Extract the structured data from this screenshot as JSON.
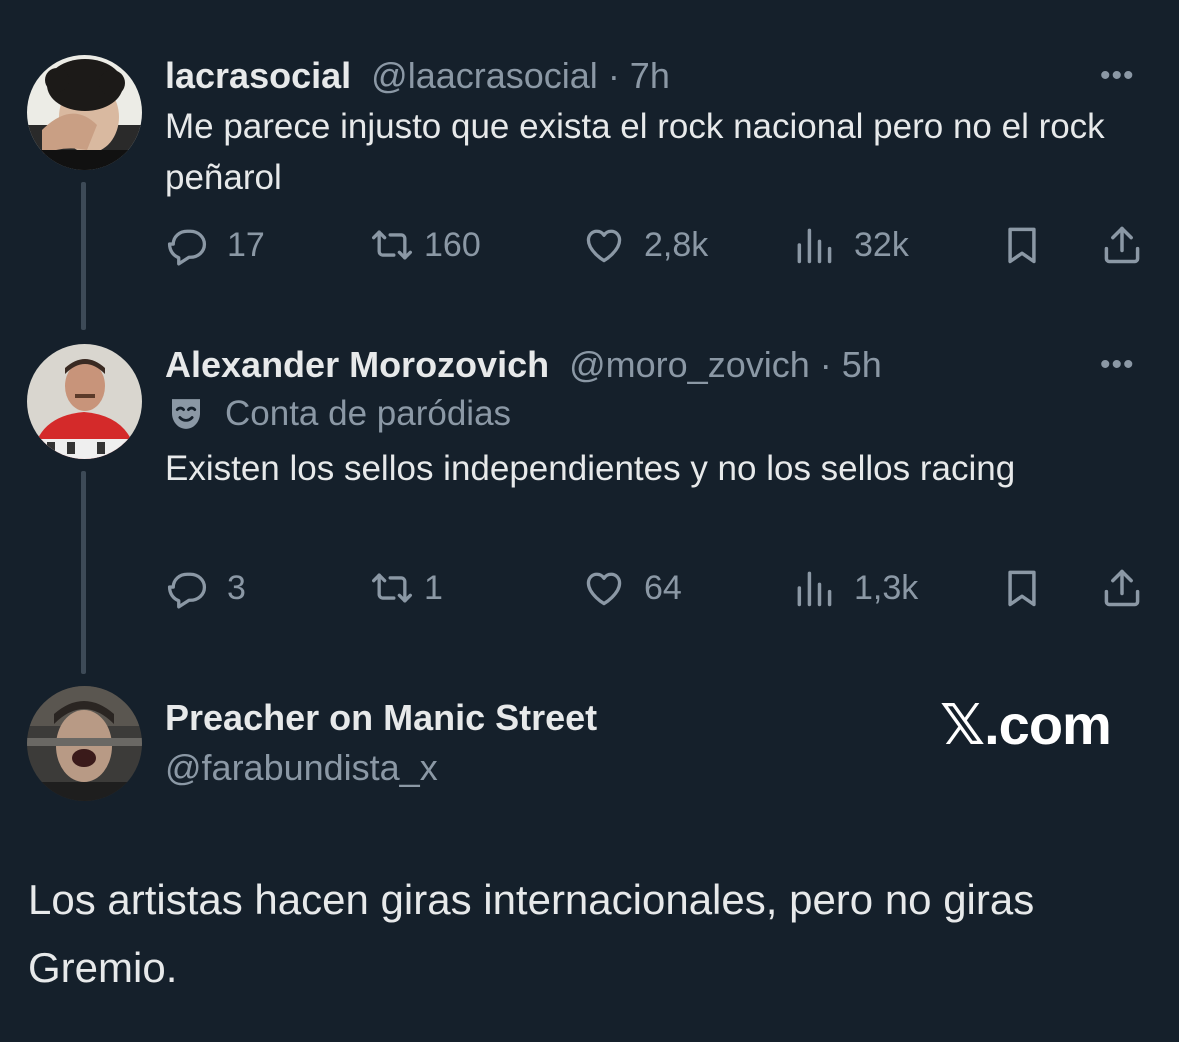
{
  "tweets": [
    {
      "name": "lacrasocial",
      "handle": "@laacrasocial",
      "time": "· 7h",
      "text": "Me parece injusto que exista el rock nacional pero no el rock peñarol",
      "replies": "17",
      "retweets": "160",
      "likes": "2,8k",
      "views": "32k",
      "more_label": "•••"
    },
    {
      "name": "Alexander Morozovich",
      "handle": "@moro_zovich",
      "time": "· 5h",
      "parody_label": "Conta de paródias",
      "text": "Existen los sellos independientes y no los sellos racing",
      "replies": "3",
      "retweets": "1",
      "likes": "64",
      "views": "1,3k",
      "more_label": "•••"
    }
  ],
  "quote": {
    "name": "Preacher on Manic Street",
    "handle": "@farabundista_x",
    "brand": "𝕏.com",
    "text": "Los artistas hacen giras internacionales, pero no giras Gremio."
  },
  "colors": {
    "background": "#15202b",
    "text": "#e7e9ea",
    "muted": "#8b98a5",
    "thread_line": "#3d4a57"
  },
  "icons": [
    "reply-icon",
    "retweet-icon",
    "like-icon",
    "views-icon",
    "bookmark-icon",
    "share-icon",
    "parody-mask-icon",
    "more-icon"
  ]
}
